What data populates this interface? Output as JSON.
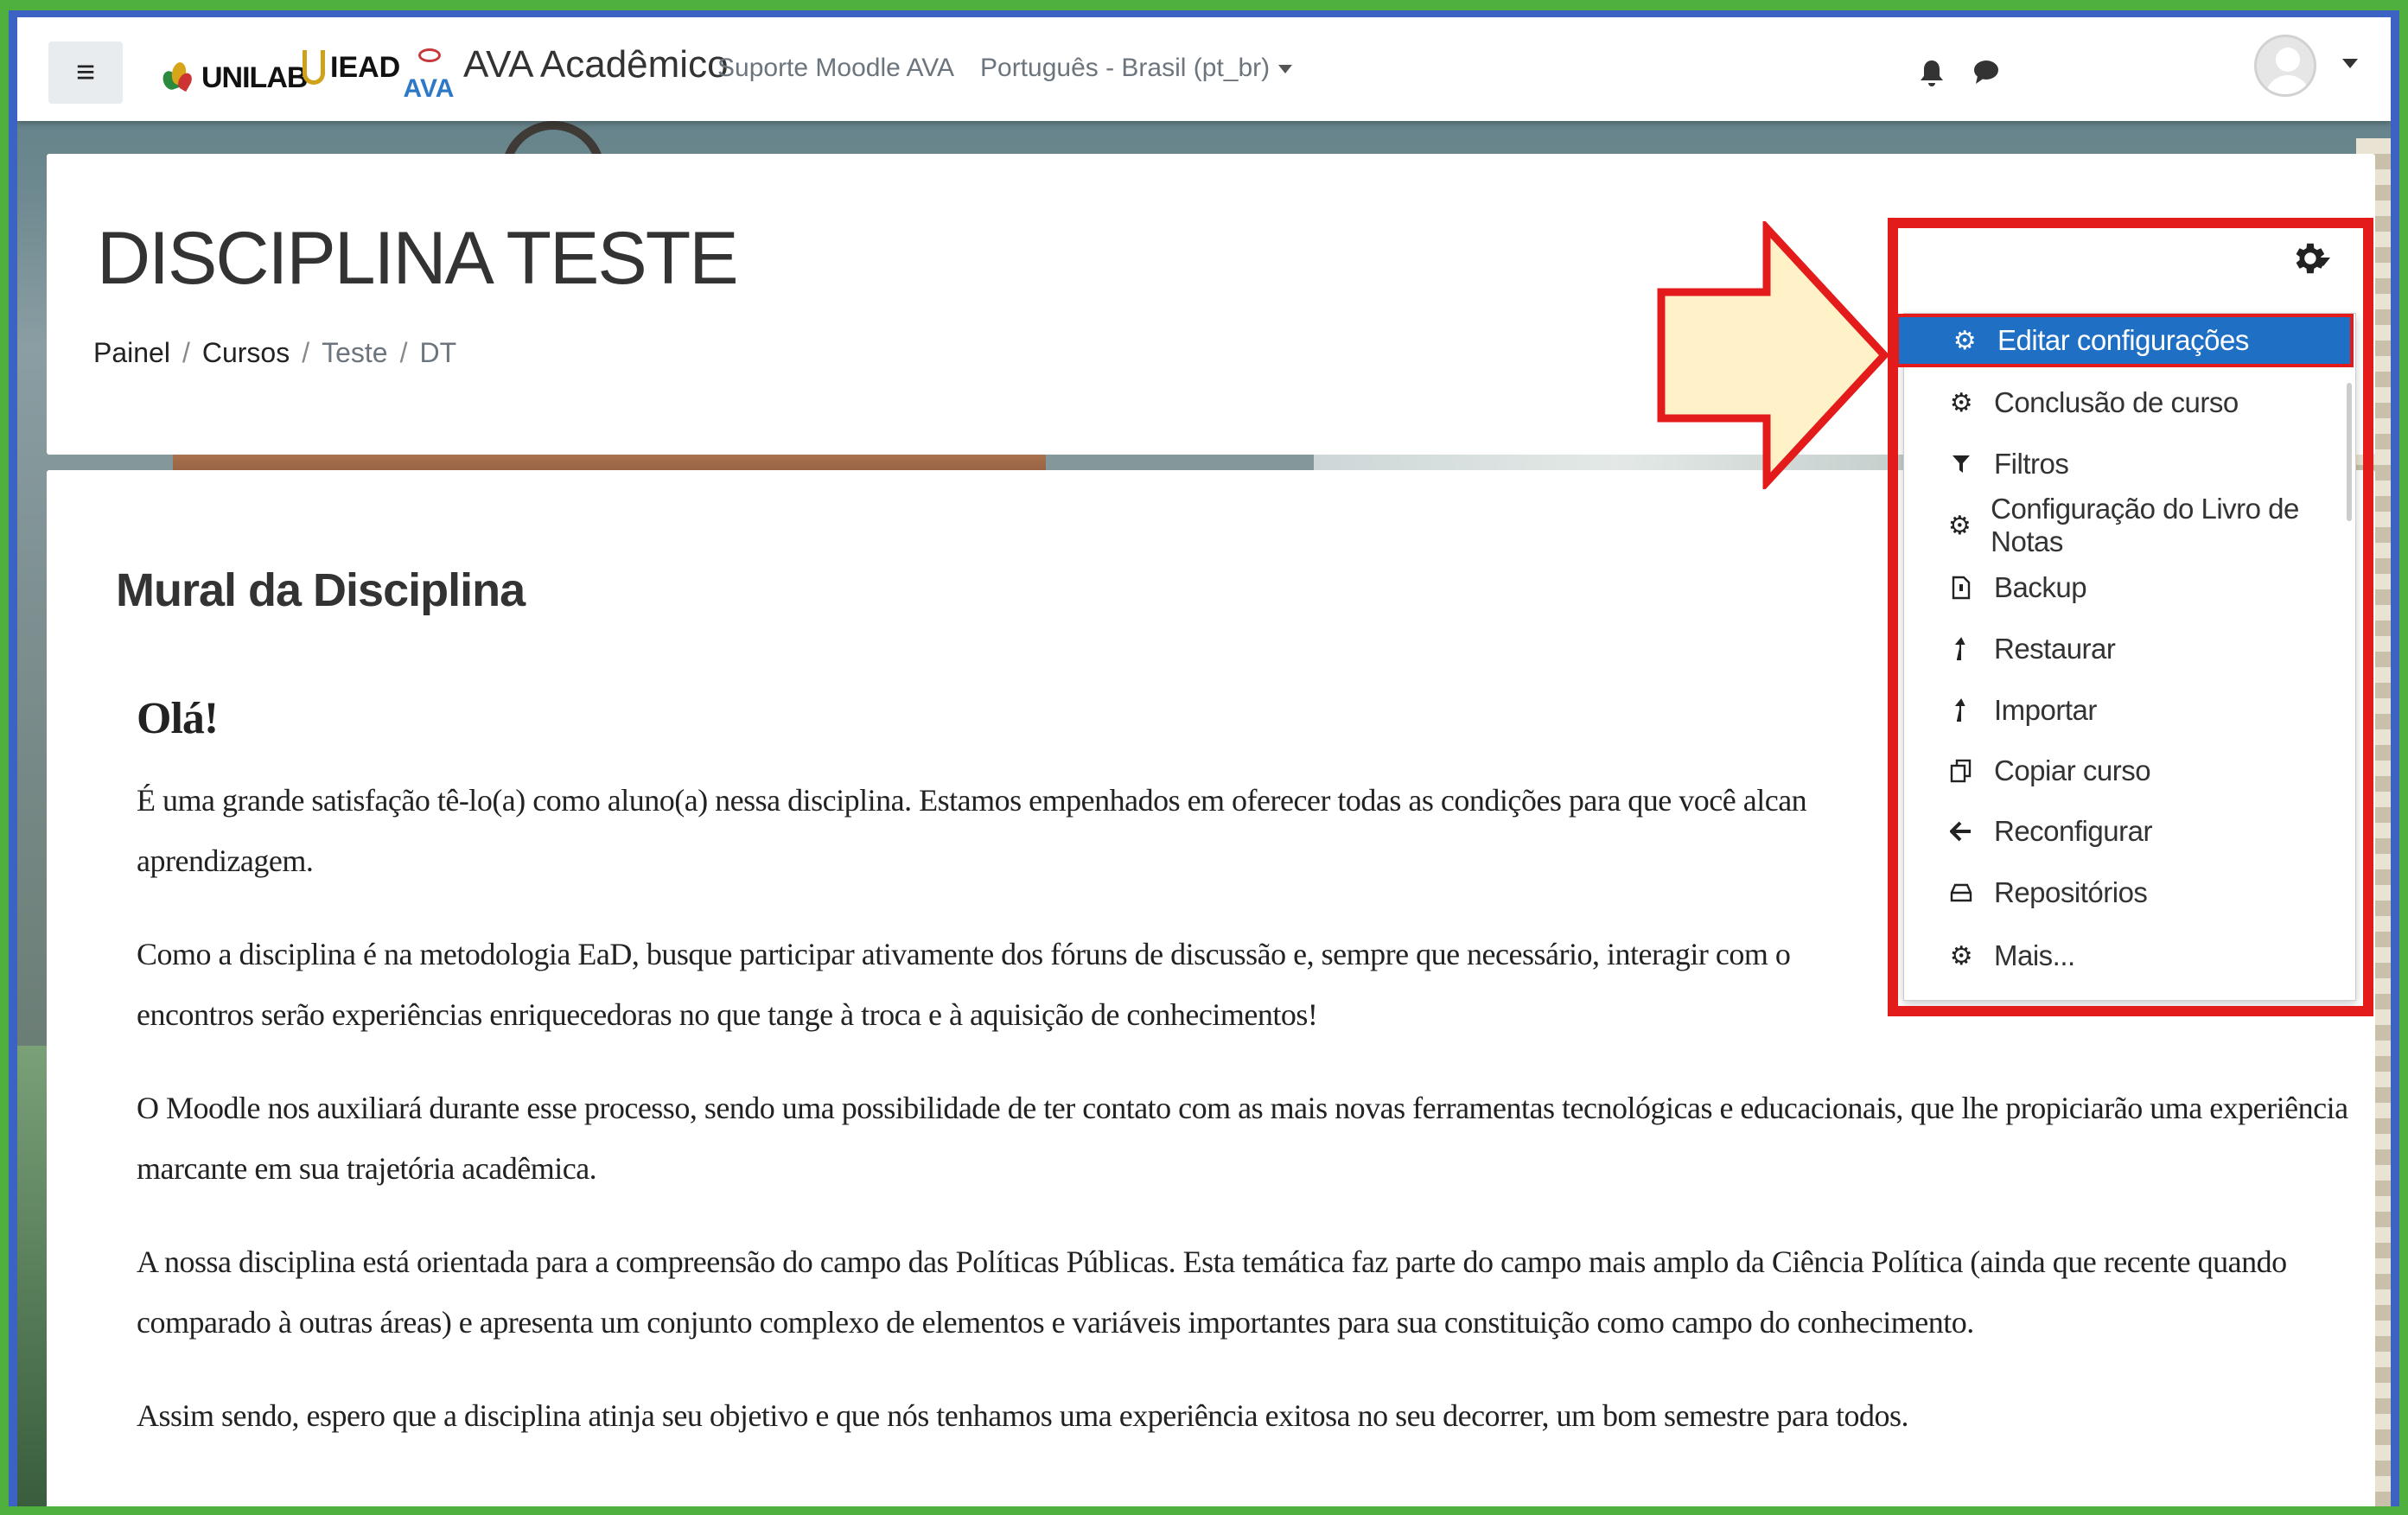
{
  "navbar": {
    "menu_icon": "hamburger-icon",
    "logo1_text": "UNILAB",
    "logo2_text": "IEAD",
    "logo3_text": "AVA",
    "site_name": "AVA Acadêmico",
    "links": [
      {
        "label": "Suporte Moodle AVA"
      },
      {
        "label": "Português - Brasil (pt_br)"
      }
    ],
    "icons": [
      "bell-icon",
      "chat-bubble-icon"
    ]
  },
  "course": {
    "title": "DISCIPLINA TESTE",
    "breadcrumb": [
      "Painel",
      "Cursos",
      "Teste",
      "DT"
    ],
    "breadcrumb_separator": "/"
  },
  "actions_menu": {
    "button_icon": "gear-icon",
    "items": [
      {
        "label": "Editar configurações",
        "icon": "gear-icon",
        "active": true
      },
      {
        "label": "Conclusão de curso",
        "icon": "gear-icon"
      },
      {
        "label": "Filtros",
        "icon": "filter-icon"
      },
      {
        "label": "Configuração do Livro de Notas",
        "icon": "gear-icon"
      },
      {
        "label": "Backup",
        "icon": "file-archive-icon"
      },
      {
        "label": "Restaurar",
        "icon": "level-up-icon"
      },
      {
        "label": "Importar",
        "icon": "level-up-icon"
      },
      {
        "label": "Copiar curso",
        "icon": "copy-icon"
      },
      {
        "label": "Reconfigurar",
        "icon": "arrow-left-icon"
      },
      {
        "label": "Repositórios",
        "icon": "hdd-icon"
      },
      {
        "label": "Mais...",
        "icon": "gear-icon"
      }
    ]
  },
  "content": {
    "section_title": "Mural da Disciplina",
    "greeting": "Olá!",
    "paragraphs": [
      "É uma grande satisfação tê-lo(a) como aluno(a) nessa disciplina. Estamos empenhados em oferecer todas as condições para que você alcan",
      "aprendizagem.",
      "Como a disciplina é na metodologia EaD, busque participar ativamente dos fóruns de discussão e, sempre que necessário, interagir com o",
      "encontros serão experiências enriquecedoras no que tange à troca e à aquisição de conhecimentos!",
      "O Moodle nos auxiliará durante esse processo, sendo uma possibilidade de ter contato com as mais novas ferramentas tecnológicas e educacionais, que lhe propiciarão uma experiência marcante em sua trajetória acadêmica.",
      "A nossa disciplina está orientada para a compreensão do campo das Políticas Públicas. Esta temática faz parte do campo mais amplo da Ciência Política (ainda que recente quando comparado à outras áreas) e apresenta um conjunto complexo de elementos e variáveis importantes para sua constituição como campo do conhecimento.",
      "Assim sendo, espero que a disciplina atinja seu objetivo e que nós tenhamos uma experiência exitosa no seu decorrer, um bom semestre para todos."
    ]
  },
  "annotation": {
    "highlight_color": "#e31b1b",
    "arrow_fill": "#fff2c8"
  }
}
